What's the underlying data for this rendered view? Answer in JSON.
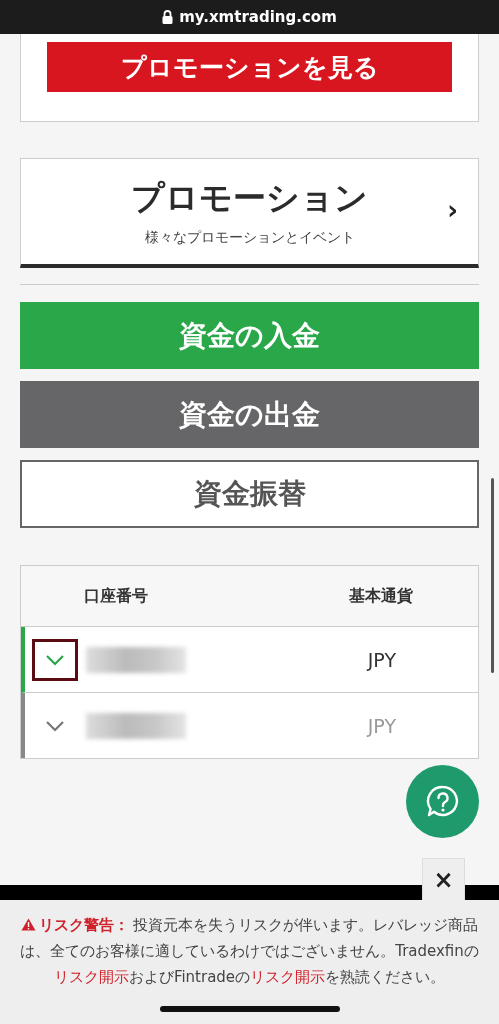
{
  "browser_bar": {
    "url": "my.xmtrading.com"
  },
  "promo_card": {
    "button": "プロモーションを見る"
  },
  "promotion_link": {
    "title": "プロモーション",
    "subtitle": "様々なプロモーションとイベント",
    "arrow": "›"
  },
  "actions": [
    {
      "kind": "primary",
      "label": "資金の入金"
    },
    {
      "kind": "secondary",
      "label": "資金の出金"
    },
    {
      "kind": "outline",
      "label": "資金振替"
    }
  ],
  "accounts_table": {
    "columns": [
      "口座番号",
      "基本通貨"
    ],
    "rows": [
      {
        "selected": true,
        "currency": "JPY"
      },
      {
        "selected": false,
        "currency": "JPY"
      }
    ]
  },
  "risk_warning": {
    "close": "×",
    "segments": [
      {
        "kind": "label",
        "text": "リスク警告："
      },
      {
        "kind": "text",
        "text": " 投資元本を失うリスクが伴います。レバレッジ商品は、全てのお客様に適しているわけではございません。Tradexfinの"
      },
      {
        "kind": "link",
        "text": "リスク開示"
      },
      {
        "kind": "text",
        "text": "およびFintradeの"
      },
      {
        "kind": "link",
        "text": "リスク開示"
      },
      {
        "kind": "text",
        "text": "を熟読ください。"
      }
    ]
  }
}
